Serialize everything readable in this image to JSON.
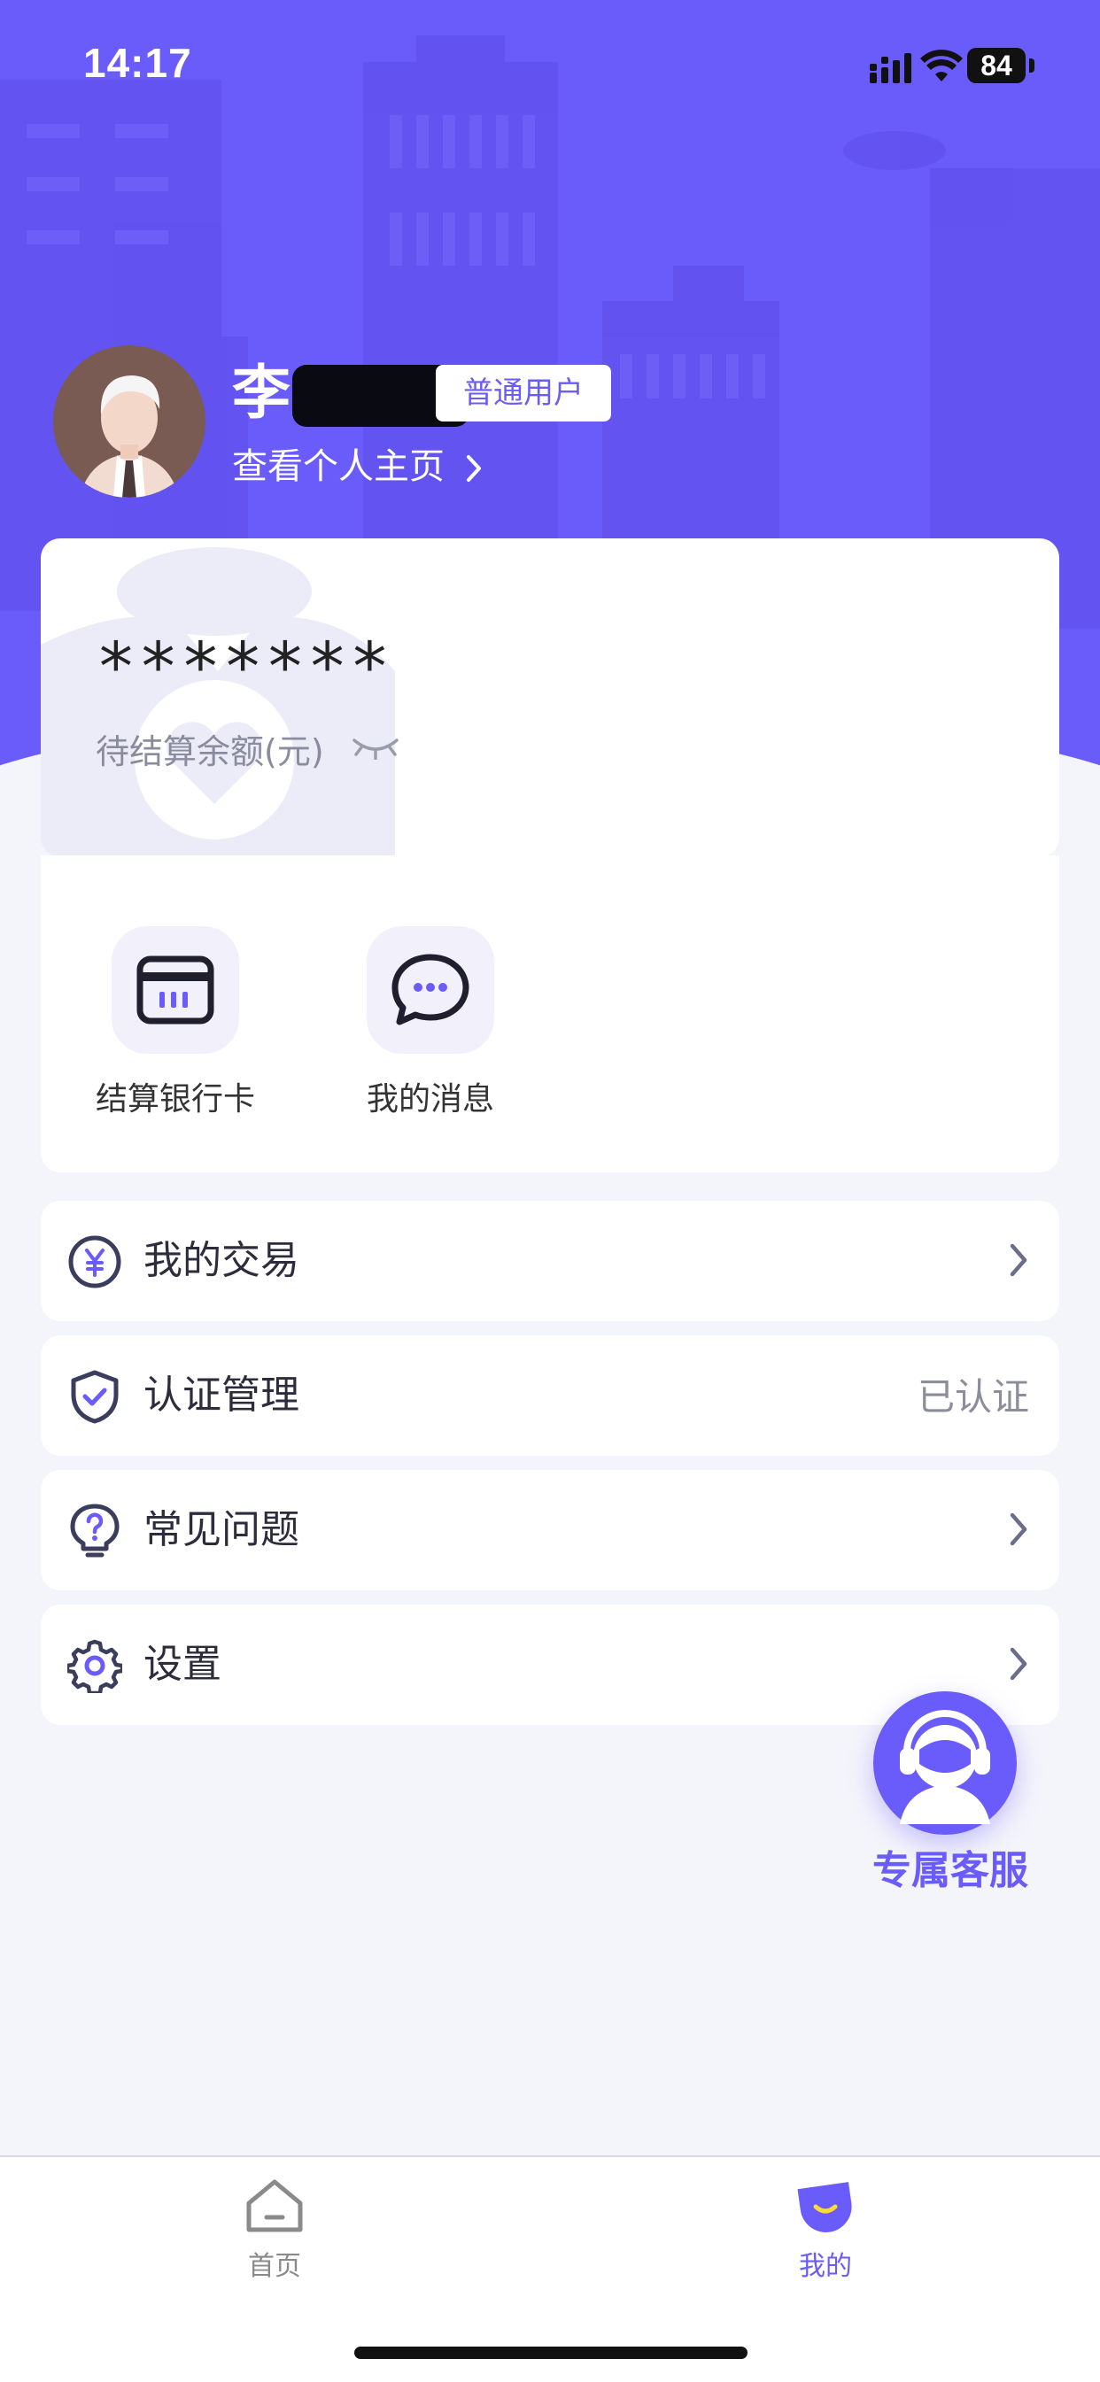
{
  "status_bar": {
    "time": "14:17",
    "battery": "84"
  },
  "profile": {
    "name": "李",
    "badge": "普通用户",
    "view_profile": "查看个人主页"
  },
  "balance": {
    "masked_value": "*******",
    "label": "待结算余额(元)"
  },
  "shortcuts": [
    {
      "label": "结算银行卡",
      "icon": "bank-card-icon"
    },
    {
      "label": "我的消息",
      "icon": "message-bubble-icon"
    }
  ],
  "menu": [
    {
      "label": "我的交易",
      "icon": "yuan-coin-icon",
      "trailing": "chevron"
    },
    {
      "label": "认证管理",
      "icon": "shield-check-icon",
      "status": "已认证"
    },
    {
      "label": "常见问题",
      "icon": "question-bulb-icon",
      "trailing": "chevron"
    },
    {
      "label": "设置",
      "icon": "gear-icon",
      "trailing": "chevron"
    }
  ],
  "customer_service": {
    "label": "专属客服",
    "icon": "headset-agent-icon"
  },
  "tabbar": [
    {
      "label": "首页",
      "icon": "home-icon",
      "active": false
    },
    {
      "label": "我的",
      "icon": "smile-profile-icon",
      "active": true
    }
  ],
  "colors": {
    "accent": "#6a5bfb",
    "background": "#f4f4fb",
    "text": "#2c2c3c",
    "muted": "#8b8d9b",
    "inactive_tab": "#8a8a8a"
  }
}
